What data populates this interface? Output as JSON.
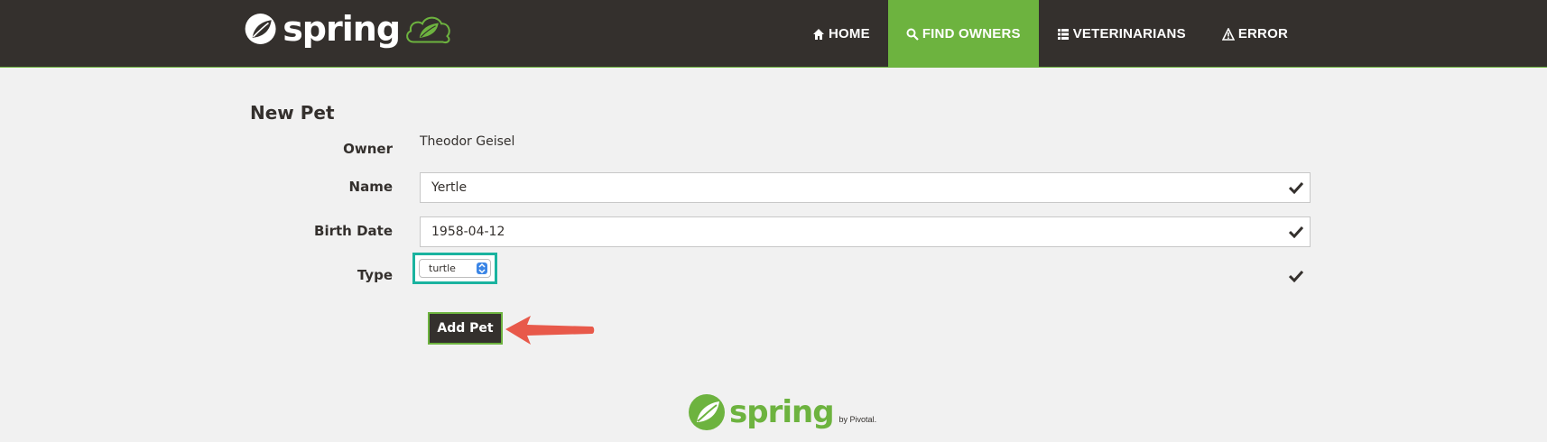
{
  "brand": {
    "name": "spring",
    "logo_icon": "spring-leaf-icon",
    "badge_icon": "cloud-leaf-icon"
  },
  "nav": [
    {
      "label": "HOME",
      "icon": "home-icon",
      "active": false
    },
    {
      "label": "FIND OWNERS",
      "icon": "search-icon",
      "active": true
    },
    {
      "label": "VETERINARIANS",
      "icon": "list-icon",
      "active": false
    },
    {
      "label": "ERROR",
      "icon": "warning-icon",
      "active": false
    }
  ],
  "form": {
    "title": "New Pet",
    "owner_label": "Owner",
    "owner_value": "Theodor Geisel",
    "name_label": "Name",
    "name_value": "Yertle",
    "birth_label": "Birth Date",
    "birth_value": "1958-04-12",
    "type_label": "Type",
    "type_value": "turtle",
    "submit_label": "Add Pet"
  },
  "footer": {
    "logo_text": "spring",
    "by_text": "by Pivotal."
  },
  "colors": {
    "nav_bg": "#34302d",
    "accent": "#6db33f",
    "highlight": "#1ab39f",
    "arrow": "#e8594a"
  }
}
